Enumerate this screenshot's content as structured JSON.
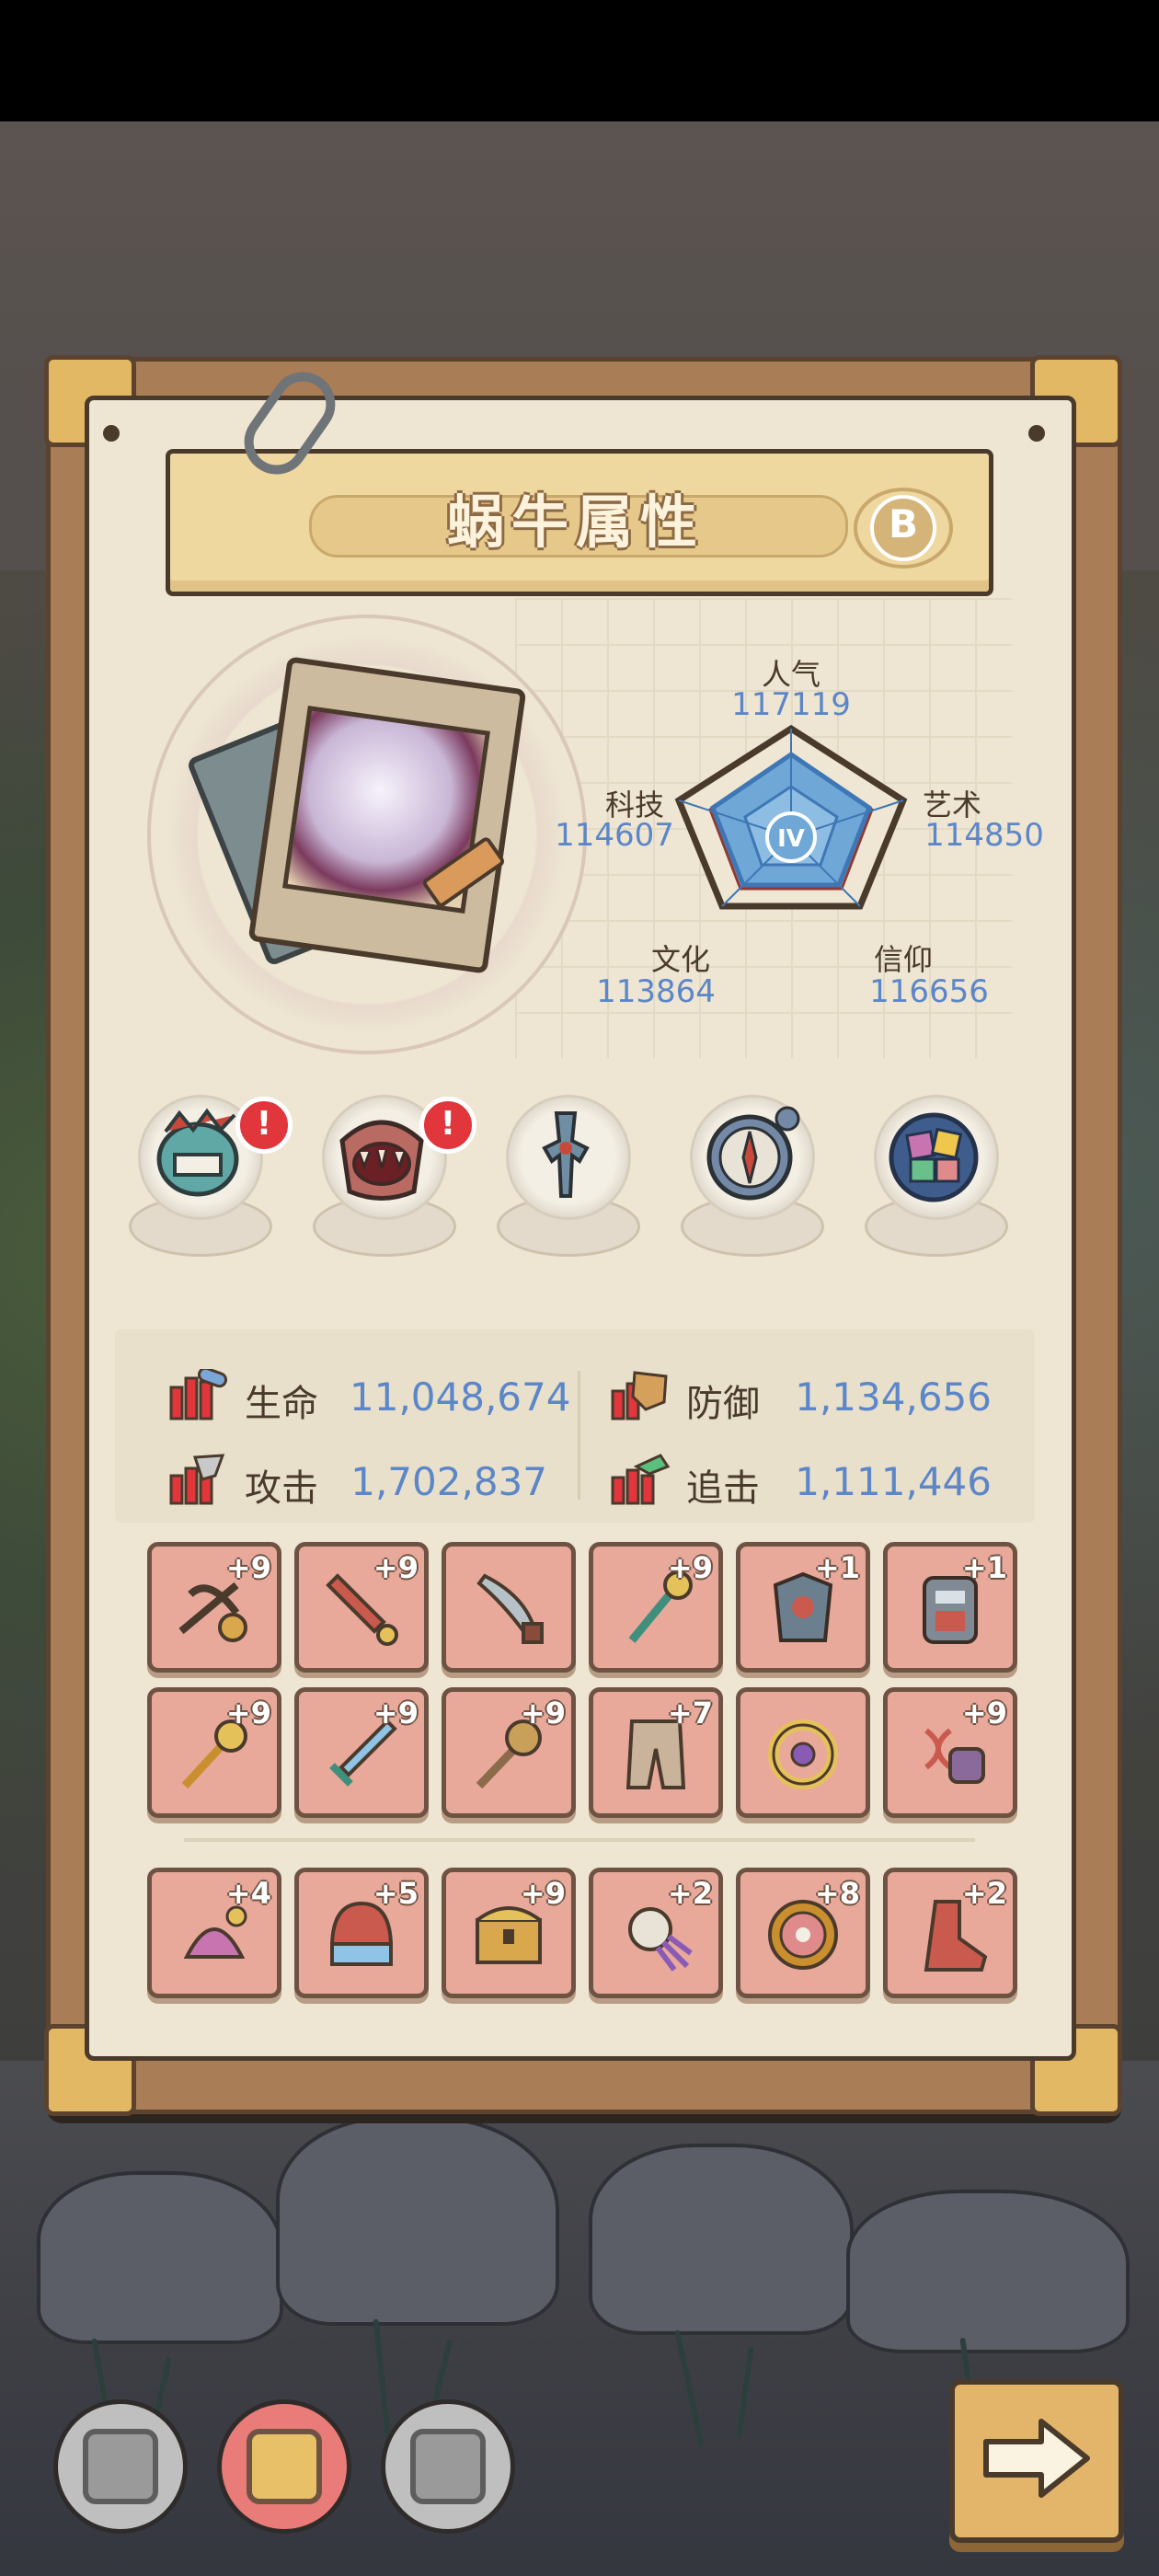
{
  "page": {
    "title": "蜗牛属性",
    "grade": "B"
  },
  "radar": {
    "level_badge": "IV",
    "stats": [
      {
        "label": "人气",
        "value": "117119"
      },
      {
        "label": "艺术",
        "value": "114850"
      },
      {
        "label": "信仰",
        "value": "116656"
      },
      {
        "label": "文化",
        "value": "113864"
      },
      {
        "label": "科技",
        "value": "114607"
      }
    ]
  },
  "equipment": [
    {
      "name": "spiked-fish-mask",
      "alert": "!"
    },
    {
      "name": "fanged-mouth-mask",
      "alert": "!"
    },
    {
      "name": "blue-sword-relic",
      "alert": ""
    },
    {
      "name": "compass-relic",
      "alert": ""
    },
    {
      "name": "gem-plate-relic",
      "alert": ""
    }
  ],
  "stats": [
    {
      "label": "生命",
      "value": "11,048,674",
      "icon": "health-icon"
    },
    {
      "label": "防御",
      "value": "1,134,656",
      "icon": "defense-icon"
    },
    {
      "label": "攻击",
      "value": "1,702,837",
      "icon": "attack-icon"
    },
    {
      "label": "追击",
      "value": "1,111,446",
      "icon": "chase-icon"
    }
  ],
  "items_top": [
    {
      "plus": "+9",
      "icon": "crossbow-icon"
    },
    {
      "plus": "+9",
      "icon": "saber-icon"
    },
    {
      "plus": "",
      "icon": "dagger-icon"
    },
    {
      "plus": "+9",
      "icon": "scepter-icon"
    },
    {
      "plus": "+1",
      "icon": "armor-icon"
    },
    {
      "plus": "+1",
      "icon": "robot-armor-icon"
    },
    {
      "plus": "+9",
      "icon": "golden-staff-icon"
    },
    {
      "plus": "+9",
      "icon": "blue-sword-icon"
    },
    {
      "plus": "+9",
      "icon": "mace-icon"
    },
    {
      "plus": "+7",
      "icon": "pants-icon"
    },
    {
      "plus": "",
      "icon": "ring-icon"
    },
    {
      "plus": "+9",
      "icon": "dna-gauntlet-icon"
    }
  ],
  "items_bottom": [
    {
      "plus": "+4",
      "icon": "shell-charm-icon"
    },
    {
      "plus": "+5",
      "icon": "helmet-icon"
    },
    {
      "plus": "+9",
      "icon": "chest-icon"
    },
    {
      "plus": "+2",
      "icon": "claw-charm-icon"
    },
    {
      "plus": "+8",
      "icon": "flower-medal-icon"
    },
    {
      "plus": "+2",
      "icon": "boot-icon"
    }
  ],
  "bottom_nav": [
    {
      "icon": "face-icon",
      "active": false
    },
    {
      "icon": "mask-icon",
      "active": true
    },
    {
      "icon": "brain-icon",
      "active": false
    }
  ],
  "colors": {
    "paper": "#eee6d2",
    "stat_value": "#5c86c8",
    "item_bg": "#e8a99b",
    "alert": "#e0363c"
  }
}
